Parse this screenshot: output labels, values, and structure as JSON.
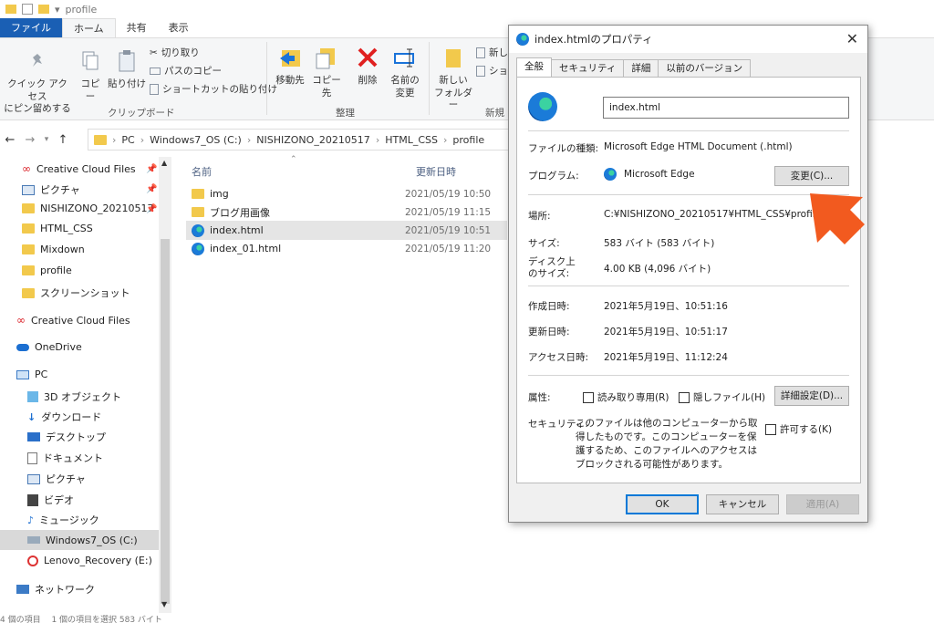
{
  "window": {
    "title": "profile",
    "menu": [
      "ファイル",
      "ホーム",
      "共有",
      "表示"
    ]
  },
  "ribbon": {
    "quick_access": "クイック アクセス\nにピン留めする",
    "copy": "コピー",
    "paste": "貼り付け",
    "cut": "切り取り",
    "copy_path": "パスのコピー",
    "paste_shortcut": "ショートカットの貼り付け",
    "clipboard_group": "クリップボード",
    "move_to": "移動先",
    "copy_to": "コピー先",
    "delete": "削除",
    "rename": "名前の\n変更",
    "organize_group": "整理",
    "new_folder": "新しい\nフォルダー",
    "new_item": "新し",
    "shortcut": "ショ",
    "new_group": "新規"
  },
  "address": {
    "crumbs": [
      "PC",
      "Windows7_OS (C:)",
      "NISHIZONO_20210517",
      "HTML_CSS",
      "profile"
    ]
  },
  "nav": {
    "items": [
      {
        "label": "Creative Cloud Files",
        "icon": "creative-cloud-icon"
      },
      {
        "label": "ピクチャ",
        "icon": "pictures-icon"
      },
      {
        "label": "NISHIZONO_20210517",
        "icon": "folder-icon"
      },
      {
        "label": "HTML_CSS",
        "icon": "folder-icon"
      },
      {
        "label": "Mixdown",
        "icon": "folder-icon"
      },
      {
        "label": "profile",
        "icon": "folder-icon"
      },
      {
        "label": "スクリーンショット",
        "icon": "folder-icon"
      },
      {
        "label": "Creative Cloud Files",
        "icon": "creative-cloud-icon"
      },
      {
        "label": "OneDrive",
        "icon": "cloud-icon"
      },
      {
        "label": "PC",
        "icon": "pc-icon"
      },
      {
        "label": "3D オブジェクト",
        "icon": "cube-icon"
      },
      {
        "label": "ダウンロード",
        "icon": "download-icon"
      },
      {
        "label": "デスクトップ",
        "icon": "desktop-icon"
      },
      {
        "label": "ドキュメント",
        "icon": "document-icon"
      },
      {
        "label": "ピクチャ",
        "icon": "pictures-icon"
      },
      {
        "label": "ビデオ",
        "icon": "video-icon"
      },
      {
        "label": "ミュージック",
        "icon": "music-icon"
      },
      {
        "label": "Windows7_OS (C:)",
        "icon": "drive-icon"
      },
      {
        "label": "Lenovo_Recovery (E:)",
        "icon": "drive-icon"
      },
      {
        "label": "ネットワーク",
        "icon": "network-icon"
      }
    ]
  },
  "files": {
    "col_name": "名前",
    "col_date": "更新日時",
    "rows": [
      {
        "name": "img",
        "date": "2021/05/19 10:50"
      },
      {
        "name": "ブログ用画像",
        "date": "2021/05/19 11:15"
      },
      {
        "name": "index.html",
        "date": "2021/05/19 10:51"
      },
      {
        "name": "index_01.html",
        "date": "2021/05/19 11:20"
      }
    ]
  },
  "statusbar": "4 個の項目　 1 個の項目を選択 583 バイト",
  "dialog": {
    "title": "index.htmlのプロパティ",
    "tabs": [
      "全般",
      "セキュリティ",
      "詳細",
      "以前のバージョン"
    ],
    "filename": "index.html",
    "type_label": "ファイルの種類:",
    "type_value": "Microsoft Edge HTML Document (.html)",
    "program_label": "プログラム:",
    "program_value": "Microsoft Edge",
    "change_button": "変更(C)...",
    "location_label": "場所:",
    "location_value": "C:¥NISHIZONO_20210517¥HTML_CSS¥profile",
    "size_label": "サイズ:",
    "size_value": "583 バイト (583 バイト)",
    "disk_size_label": "ディスク上\nのサイズ:",
    "disk_size_value": "4.00 KB (4,096 バイト)",
    "created_label": "作成日時:",
    "created_value": "2021年5月19日、10:51:16",
    "modified_label": "更新日時:",
    "modified_value": "2021年5月19日、10:51:17",
    "accessed_label": "アクセス日時:",
    "accessed_value": "2021年5月19日、11:12:24",
    "attributes_label": "属性:",
    "readonly": "読み取り専用(R)",
    "hidden": "隠しファイル(H)",
    "advanced_button": "詳細設定(D)...",
    "security_label": "セキュリティ:",
    "security_text": "このファイルは他のコンピューターから取得したものです。このコンピューターを保護するため、このファイルへのアクセスはブロックされる可能性があります。",
    "allow": "許可する(K)",
    "ok": "OK",
    "cancel": "キャンセル",
    "apply": "適用(A)"
  },
  "colors": {
    "accent": "#0078d7",
    "arrow": "#f25a1f",
    "file_tab": "#1a5fb4"
  }
}
